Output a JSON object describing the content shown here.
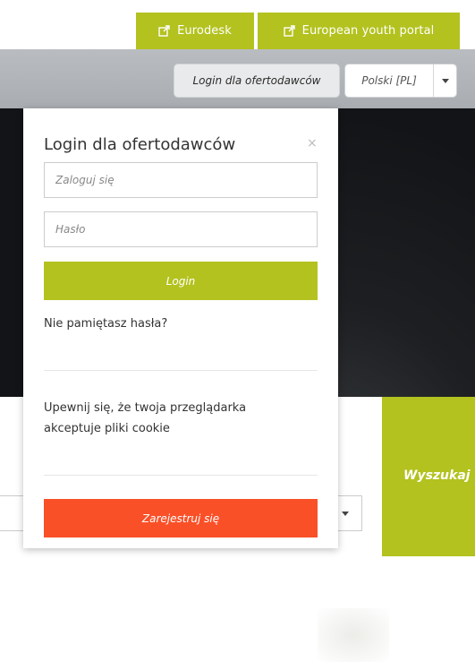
{
  "top_links": [
    {
      "label": "Eurodesk",
      "icon": "external-link-icon"
    },
    {
      "label": "European youth portal",
      "icon": "external-link-icon"
    }
  ],
  "header": {
    "login_button": "Login dla ofertodawców",
    "language": {
      "selected": "Polski [PL]",
      "icon": "chevron-down-icon"
    }
  },
  "hero": {
    "search_button": "Wyszukaj"
  },
  "login_panel": {
    "title": "Login dla ofertodawców",
    "close": "×",
    "username_placeholder": "Zaloguj się",
    "password_placeholder": "Hasło",
    "login_label": "Login",
    "forgot_password": "Nie pamiętasz hasła?",
    "cookie_notice": "Upewnij się, że twoja przeglądarka akceptuje pliki cookie",
    "register_label": "Zarejestruj się"
  },
  "colors": {
    "accent_green": "#b3c21f",
    "register_red": "#fa5028",
    "header_gray": "#b1b4b8"
  }
}
